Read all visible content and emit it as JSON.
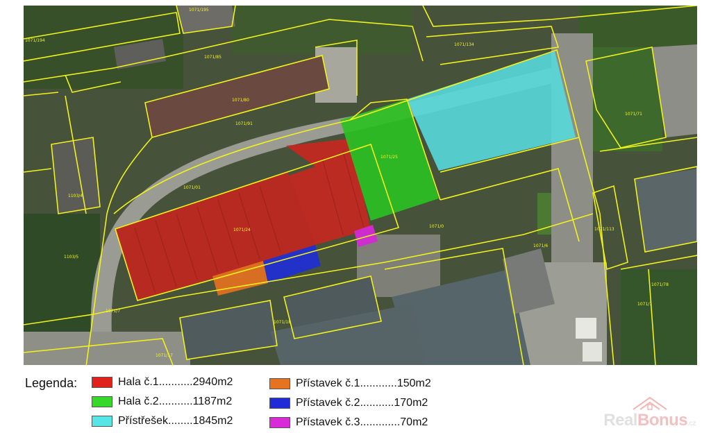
{
  "legend": {
    "title": "Legenda:",
    "items": [
      {
        "label": "Hala č.1...........2940m2",
        "color": "#e0211c"
      },
      {
        "label": "Hala č.2...........1187m2",
        "color": "#36d82a"
      },
      {
        "label": "Přístřešek........1845m2",
        "color": "#56e6e6"
      },
      {
        "label": "Přístavek č.1............150m2",
        "color": "#e5731f"
      },
      {
        "label": "Přístavek č.2...........170m2",
        "color": "#1f2bd6"
      },
      {
        "label": "Přístavek č.3.............70m2",
        "color": "#d92ad9"
      }
    ]
  },
  "parcels": {
    "p1": "1071/194",
    "p2": "1071/195",
    "p3": "1071/85",
    "p4": "1071/134",
    "p5": "1071/80",
    "p6": "1071/91",
    "p7": "1071/71",
    "p8": "1071/25",
    "p9": "1071/01",
    "p10": "1071/24",
    "p11": "1103/4",
    "p12": "1103/5",
    "p13": "1071/0",
    "p14": "1071/113",
    "p15": "1071/6",
    "p16": "1071/7",
    "p17": "1071/18",
    "p18": "1071/17",
    "p19": "1071/78",
    "p20": "1071/1"
  },
  "watermark": {
    "real": "Real",
    "bonus": "Bonus",
    "suffix": ".cz"
  }
}
